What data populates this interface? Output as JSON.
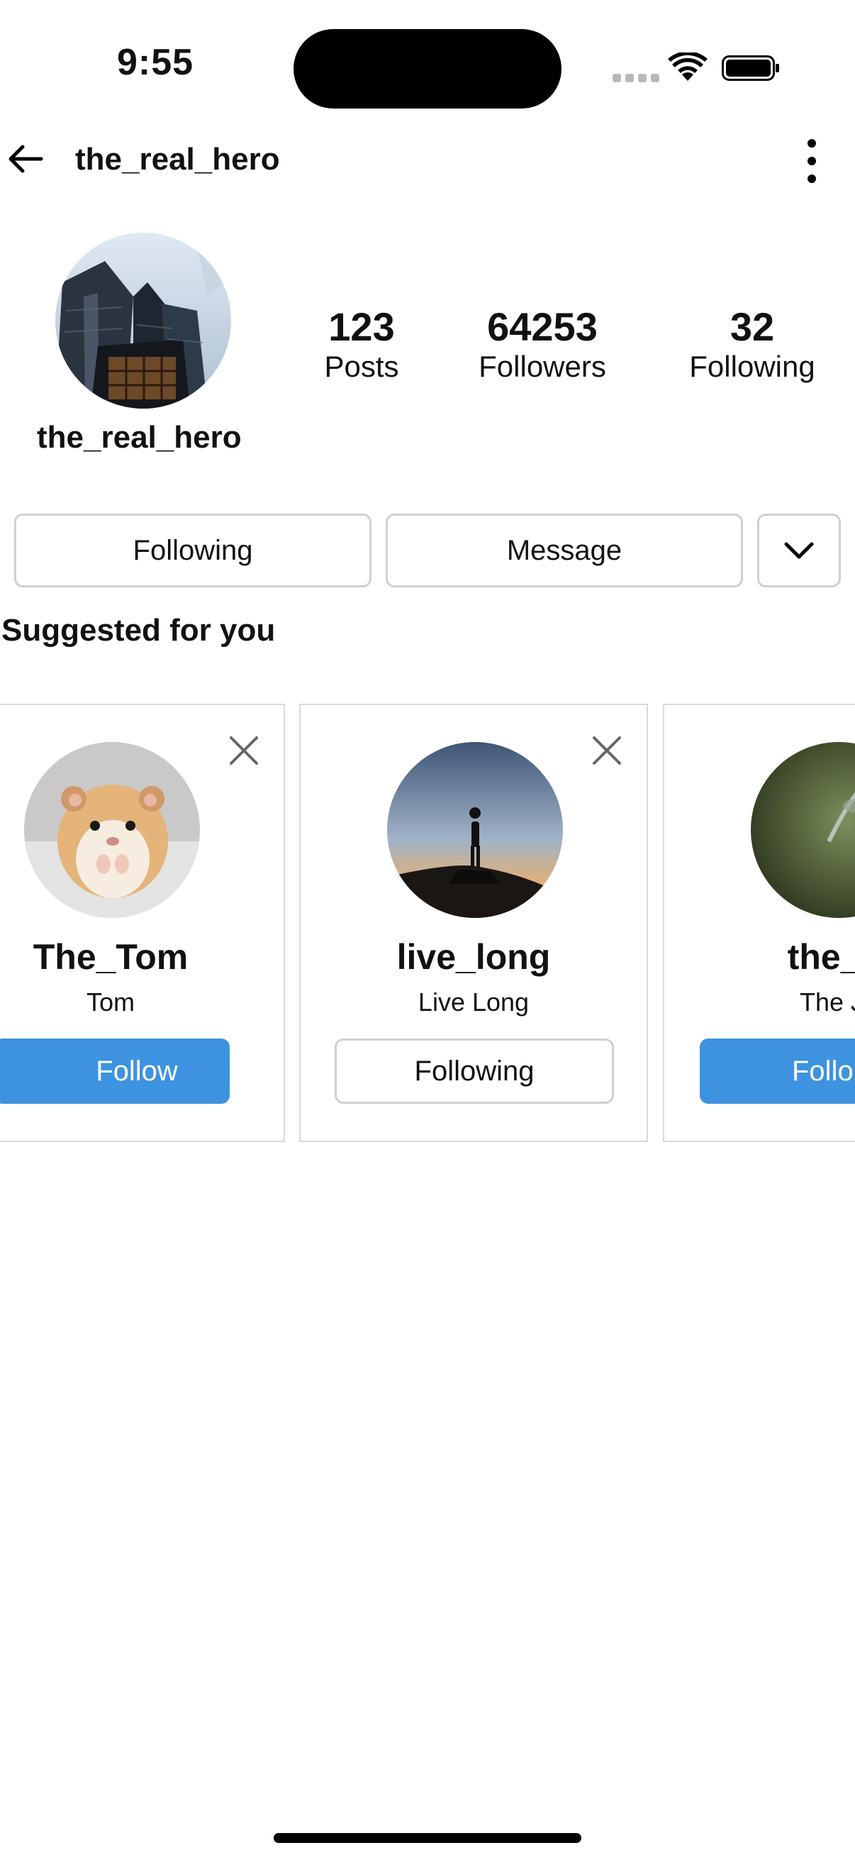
{
  "status_bar": {
    "time": "9:55"
  },
  "header": {
    "username": "the_real_hero",
    "back_icon": "arrow-left-icon",
    "more_icon": "more-vertical-icon"
  },
  "profile": {
    "name": "the_real_hero",
    "stats": {
      "posts": {
        "value": "123",
        "label": "Posts"
      },
      "followers": {
        "value": "64253",
        "label": "Followers"
      },
      "following": {
        "value": "32",
        "label": "Following"
      }
    }
  },
  "actions": {
    "following_label": "Following",
    "message_label": "Message",
    "dropdown_icon": "chevron-down-icon"
  },
  "suggested": {
    "title": "Suggested for you",
    "cards": [
      {
        "username": "The_Tom",
        "full_name": "Tom",
        "button_label": "Follow",
        "state": "follow"
      },
      {
        "username": "live_long",
        "full_name": "Live Long",
        "button_label": "Following",
        "state": "following"
      },
      {
        "username": "the_je",
        "full_name": "The Je",
        "button_label": "Follo",
        "state": "follow"
      }
    ]
  },
  "colors": {
    "follow_blue": "#3d93df",
    "border_gray": "#d0d0d0"
  }
}
